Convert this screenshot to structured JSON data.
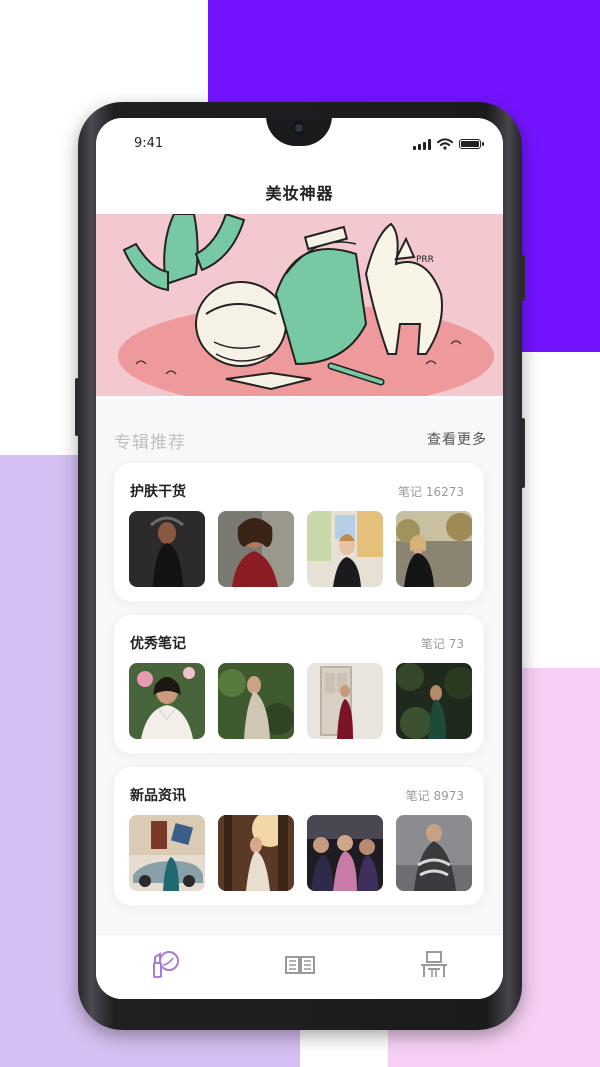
{
  "status": {
    "time": "9:41"
  },
  "app": {
    "title": "美妆神器"
  },
  "section": {
    "title": "专辑推荐",
    "more": "查看更多"
  },
  "cards": [
    {
      "title": "护肤干货",
      "count": "笔记 16273"
    },
    {
      "title": "优秀笔记",
      "count": "笔记 73"
    },
    {
      "title": "新品资讯",
      "count": "笔记 8973"
    }
  ],
  "tabs": [
    {
      "icon": "lipstick-mirror-icon",
      "active": true
    },
    {
      "icon": "open-book-icon",
      "active": false
    },
    {
      "icon": "vanity-table-icon",
      "active": false
    }
  ],
  "colors": {
    "brand_purple": "#7414ff",
    "lavender": "#d6bff2",
    "pink": "#f6d0f4",
    "hero_pink": "#f3c9cf",
    "active_tab": "#a77bd8",
    "inactive_tab": "#9a9a9e"
  }
}
